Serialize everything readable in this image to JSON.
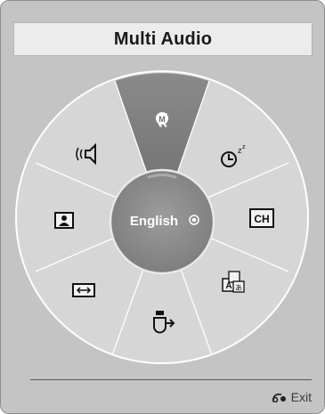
{
  "title": "Multi Audio",
  "center_label": "English",
  "exit_label": "Exit",
  "segments": [
    {
      "name": "multi-audio-icon",
      "glyph": "((M))",
      "selected": true
    },
    {
      "name": "sleep-timer-icon",
      "glyph": "clock-zz"
    },
    {
      "name": "ch-button-icon",
      "glyph": "CH"
    },
    {
      "name": "language-icon",
      "glyph": "A-kanji"
    },
    {
      "name": "input-source-icon",
      "glyph": "plug-arrow"
    },
    {
      "name": "aspect-ratio-icon",
      "glyph": "double-arrow"
    },
    {
      "name": "picture-mode-icon",
      "glyph": "person-frame"
    },
    {
      "name": "audio-mode-icon",
      "glyph": "speaker"
    }
  ],
  "colors": {
    "panel": "#c4c4c4",
    "wheel_outer": "#cecece",
    "selected_segment": "#7a7a7a",
    "center_circle": "#8a8a8a",
    "center_text": "#ffffff"
  }
}
